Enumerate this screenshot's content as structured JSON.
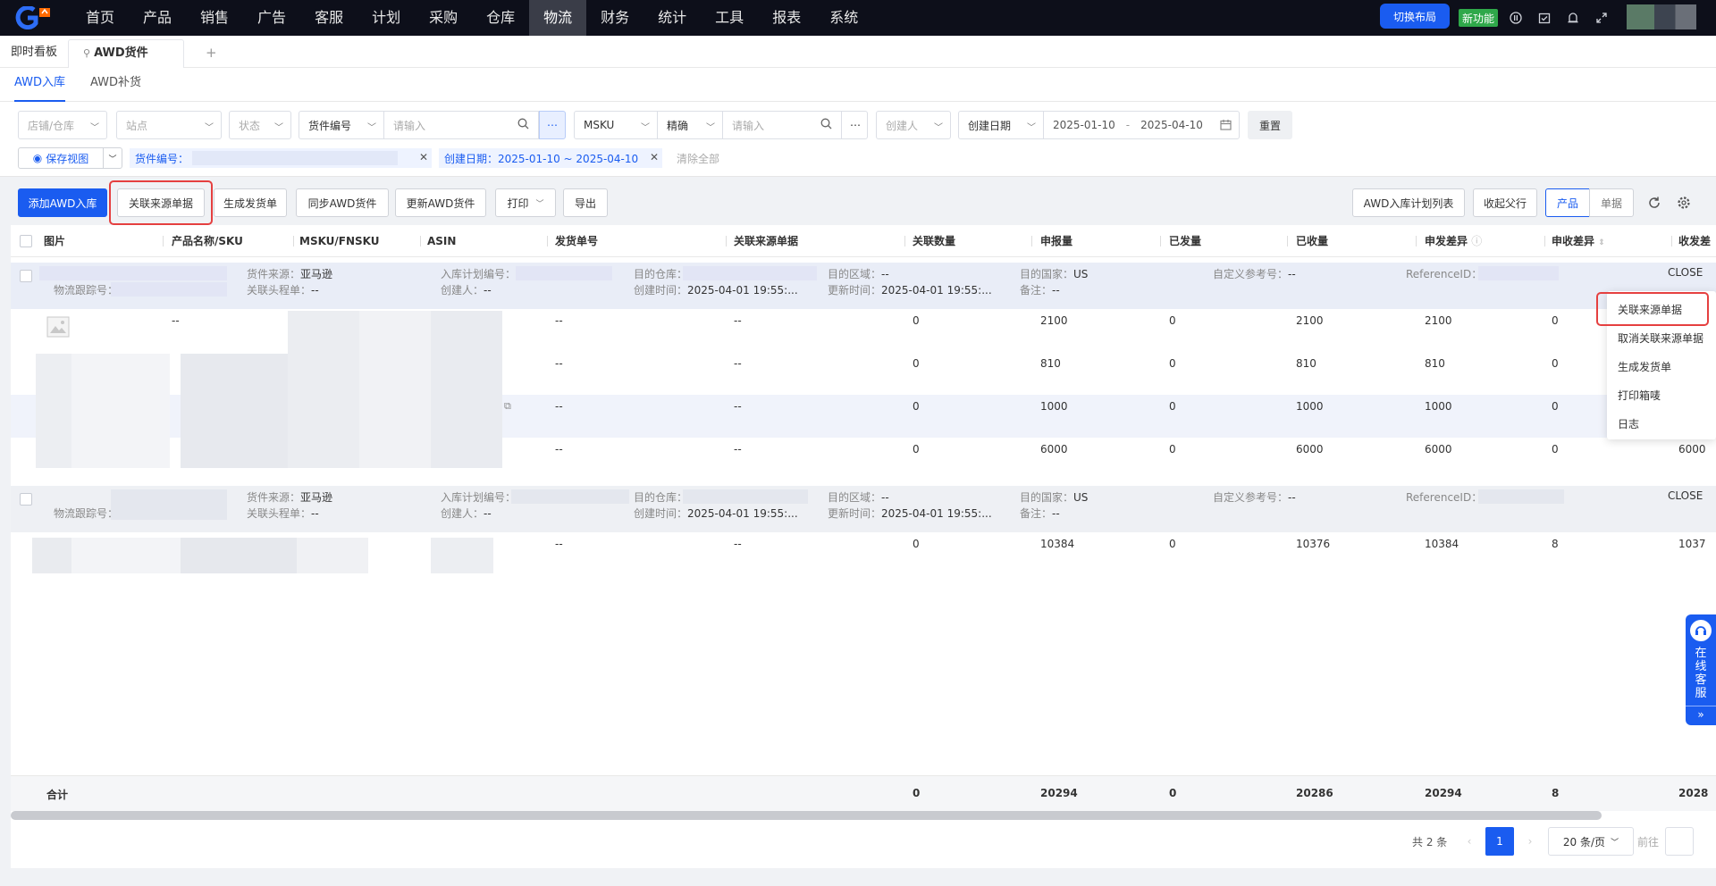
{
  "nav": {
    "items": [
      "首页",
      "产品",
      "销售",
      "广告",
      "客服",
      "计划",
      "采购",
      "仓库",
      "物流",
      "财务",
      "统计",
      "工具",
      "报表",
      "系统"
    ],
    "active": "物流",
    "switch_layout": "切换布局",
    "new_feature": "新功能"
  },
  "page_tabs": {
    "dashboard": "即时看板",
    "current": "AWD货件",
    "add": "+"
  },
  "sub_tabs": {
    "inbound": "AWD入库",
    "replenish": "AWD补货"
  },
  "filters": {
    "shop_warehouse": "店铺/仓库",
    "site": "站点",
    "status": "状态",
    "shipment_no": "货件编号",
    "input_placeholder": "请输入",
    "msku": "MSKU",
    "exact": "精确",
    "input_placeholder2": "请输入",
    "creator": "创建人",
    "created_date": "创建日期",
    "date_start": "2025-01-10",
    "date_sep": "-",
    "date_end": "2025-04-10",
    "reset": "重置",
    "save_view": "保存视图",
    "chip_shipment": "货件编号：",
    "chip_date": "创建日期：2025-01-10 ~ 2025-04-10",
    "clear_all": "清除全部"
  },
  "toolbar": {
    "add_inbound": "添加AWD入库",
    "link_source": "关联来源单据",
    "gen_shipping": "生成发货单",
    "sync_awd": "同步AWD货件",
    "update_awd": "更新AWD货件",
    "print": "打印",
    "export": "导出",
    "plan_list": "AWD入库计划列表",
    "collapse_parent": "收起父行",
    "view_product": "产品",
    "view_doc": "单据"
  },
  "columns": [
    "图片",
    "产品名称/SKU",
    "MSKU/FNSKU",
    "ASIN",
    "发货单号",
    "关联来源单据",
    "关联数量",
    "申报量",
    "已发量",
    "已收量",
    "申发差异",
    "申收差异",
    "收发差"
  ],
  "groups": [
    {
      "source_label": "货件来源：",
      "source": "亚马逊",
      "header_no_label": "关联头程单：",
      "header_no": "--",
      "tracking_label": "物流跟踪号：",
      "plan_label": "入库计划编号：",
      "creator_label": "创建人：",
      "creator": "--",
      "dest_wh_label": "目的仓库：",
      "created_label": "创建时间：",
      "created": "2025-04-01 19:55:...",
      "region_label": "目的区域：",
      "region": "--",
      "updated_label": "更新时间：",
      "updated": "2025-04-01 19:55:...",
      "country_label": "目的国家：",
      "country": "US",
      "remark_label": "备注：",
      "remark": "--",
      "custom_ref_label": "自定义参考号：",
      "custom_ref": "--",
      "ref_id_label": "ReferenceID：",
      "status": "CLOSE"
    },
    {
      "source_label": "货件来源：",
      "source": "亚马逊",
      "header_no_label": "关联头程单：",
      "header_no": "--",
      "tracking_label": "物流跟踪号：",
      "plan_label": "入库计划编号：",
      "creator_label": "创建人：",
      "creator": "--",
      "dest_wh_label": "目的仓库：",
      "created_label": "创建时间：",
      "created": "2025-04-01 19:55:...",
      "region_label": "目的区域：",
      "region": "--",
      "updated_label": "更新时间：",
      "updated": "2025-04-01 19:55:...",
      "country_label": "目的国家：",
      "country": "US",
      "remark_label": "备注：",
      "remark": "--",
      "custom_ref_label": "自定义参考号：",
      "custom_ref": "--",
      "ref_id_label": "ReferenceID：",
      "status": "CLOSE"
    }
  ],
  "rows": [
    {
      "name": "--",
      "ship_no": "--",
      "source": "--",
      "linked": "0",
      "declared": "2100",
      "shipped": "0",
      "received": "2100",
      "decl_ship_diff": "2100",
      "decl_recv_diff": "0",
      "recv_ship": ""
    },
    {
      "name": "",
      "ship_no": "--",
      "source": "--",
      "linked": "0",
      "declared": "810",
      "shipped": "0",
      "received": "810",
      "decl_ship_diff": "810",
      "decl_recv_diff": "0",
      "recv_ship": ""
    },
    {
      "name": "",
      "ship_no": "--",
      "source": "--",
      "linked": "0",
      "declared": "1000",
      "shipped": "0",
      "received": "1000",
      "decl_ship_diff": "1000",
      "decl_recv_diff": "0",
      "recv_ship": ""
    },
    {
      "name": "",
      "ship_no": "--",
      "source": "--",
      "linked": "0",
      "declared": "6000",
      "shipped": "0",
      "received": "6000",
      "decl_ship_diff": "6000",
      "decl_recv_diff": "0",
      "recv_ship": "6000"
    },
    {
      "name": "",
      "ship_no": "--",
      "source": "--",
      "linked": "0",
      "declared": "10384",
      "shipped": "0",
      "received": "10376",
      "decl_ship_diff": "10384",
      "decl_recv_diff": "8",
      "recv_ship": "1037"
    }
  ],
  "totals": {
    "label": "合计",
    "linked": "0",
    "declared": "20294",
    "shipped": "0",
    "received": "20286",
    "decl_ship_diff": "20294",
    "decl_recv_diff": "8",
    "recv_ship": "2028"
  },
  "pagination": {
    "total": "共 2 条",
    "current": "1",
    "per_page": "20 条/页",
    "goto": "前往"
  },
  "context_menu": [
    "关联来源单据",
    "取消关联来源单据",
    "生成发货单",
    "打印箱唛",
    "日志"
  ],
  "customer_service": [
    "在",
    "线",
    "客",
    "服"
  ],
  "colors": {
    "primary": "#1a5cf0",
    "nav_bg": "#0d0f1a",
    "highlight_red": "#e54040",
    "new_green": "#2fa84a"
  }
}
